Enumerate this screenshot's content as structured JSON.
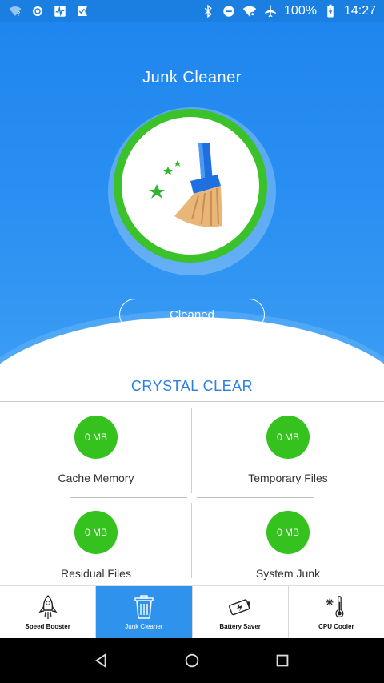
{
  "status_bar": {
    "battery_percent": "100%",
    "time": "14:27",
    "left_icons": [
      "wifi-question-icon",
      "circle-notification-icon",
      "activity-icon",
      "check-flag-icon"
    ],
    "right_icons": [
      "bluetooth-icon",
      "do-not-disturb-icon",
      "wifi-icon",
      "airplane-icon",
      "battery-icon"
    ]
  },
  "hero": {
    "title": "Junk Cleaner",
    "button_label": "Cleaned",
    "colors": {
      "background": "#1f86ef",
      "ring": "#3bc12a"
    }
  },
  "section": {
    "title": "CRYSTAL CLEAR"
  },
  "stats": [
    {
      "value": "0 MB",
      "label": "Cache Memory"
    },
    {
      "value": "0 MB",
      "label": "Temporary Files"
    },
    {
      "value": "0 MB",
      "label": "Residual Files"
    },
    {
      "value": "0 MB",
      "label": "System Junk"
    }
  ],
  "bottom_nav": [
    {
      "label": "Speed Booster",
      "icon": "rocket-icon",
      "active": false
    },
    {
      "label": "Junk Cleaner",
      "icon": "trash-icon",
      "active": true
    },
    {
      "label": "Battery Saver",
      "icon": "battery-bolt-icon",
      "active": false
    },
    {
      "label": "CPU Cooler",
      "icon": "thermometer-snowflake-icon",
      "active": false
    }
  ],
  "system_nav": [
    "back-icon",
    "home-icon",
    "recents-icon"
  ]
}
